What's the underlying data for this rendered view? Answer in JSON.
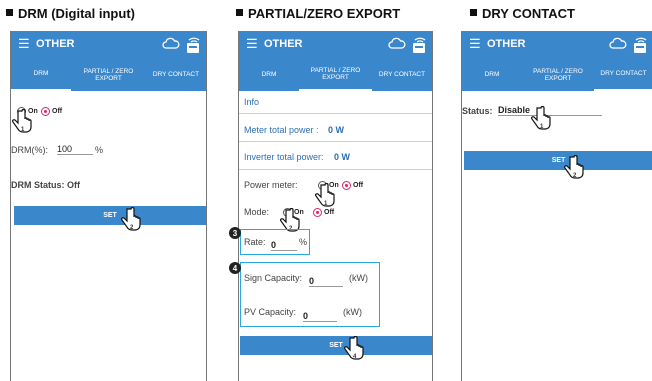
{
  "captions": {
    "drm": "DRM (Digital input)",
    "partial": "PARTIAL/ZERO EXPORT",
    "dry": "DRY CONTACT"
  },
  "appbar": {
    "title": "OTHER",
    "menu_icon": "hamburger-menu-icon",
    "cloud_icon": "cloud-icon",
    "wifi_icon": "wifi-settings-icon"
  },
  "tabs": {
    "drm": "DRM",
    "partial_line1": "PARTIAL / ZERO",
    "partial_line2": "EXPORT",
    "dry": "DRY CONTACT"
  },
  "radio": {
    "on": "On",
    "off": "Off"
  },
  "drm_panel": {
    "drm_pct_label": "DRM(%):",
    "drm_pct_value": "100",
    "drm_pct_unit": "%",
    "status_label": "DRM Status:",
    "status_value": "Off",
    "set": "SET",
    "hand1": "1",
    "hand2": "2"
  },
  "partial_panel": {
    "info": "Info",
    "meter_power_label": "Meter total power :",
    "meter_power_value": "0 W",
    "inverter_power_label": "Inverter total power:",
    "inverter_power_value": "0 W",
    "power_meter_label": "Power meter:",
    "mode_label": "Mode:",
    "rate_label": "Rate:",
    "rate_value": "0",
    "rate_unit": "%",
    "sign_capacity_label": "Sign Capacity:",
    "sign_capacity_value": "0",
    "sign_capacity_unit": "(kW)",
    "pv_capacity_label": "PV Capacity:",
    "pv_capacity_value": "0",
    "pv_capacity_unit": "(kW)",
    "set": "SET",
    "badge3": "3",
    "badge4": "4",
    "hand1": "1",
    "hand2": "2",
    "hand4": "4"
  },
  "dry_panel": {
    "status_label": "Status:",
    "status_value": "Disable",
    "set": "SET",
    "hand1": "1",
    "hand2": "2"
  },
  "colors": {
    "accent": "#3b87cc",
    "radio_on": "#e0245e",
    "highlight": "#29a8e0"
  }
}
